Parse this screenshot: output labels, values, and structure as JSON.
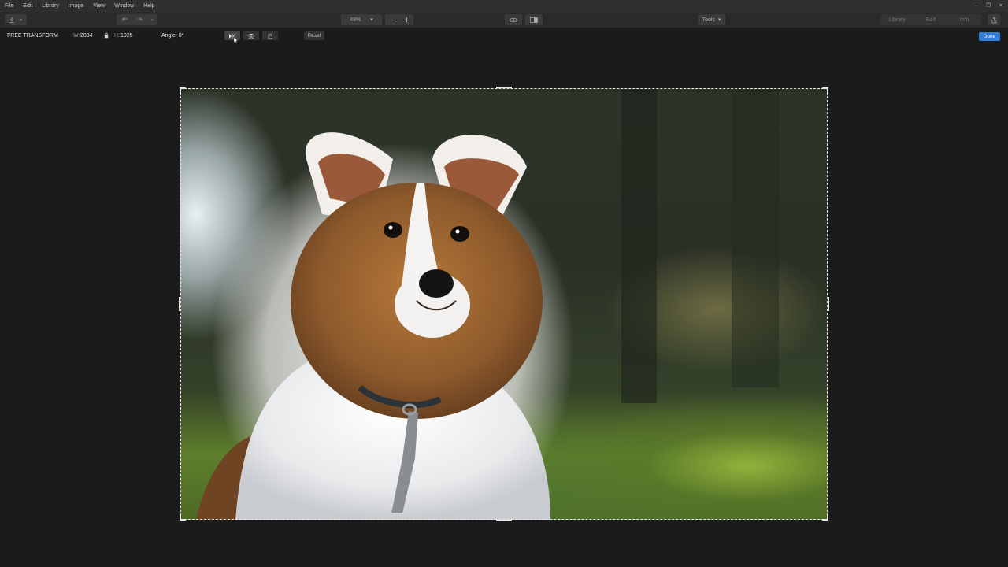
{
  "menu": [
    "File",
    "Edit",
    "Library",
    "Image",
    "View",
    "Window",
    "Help"
  ],
  "window_controls": [
    "–",
    "❐",
    "✕"
  ],
  "toolbar": {
    "zoom": "48%",
    "tools_label": "Tools",
    "tabs": [
      "Library",
      "Edit",
      "Info"
    ]
  },
  "options": {
    "mode_label": "FREE TRANSFORM",
    "w_label": "W:",
    "w_value": "2884",
    "h_label": "H:",
    "h_value": "1925",
    "angle_label": "Angle: 0°",
    "reset_label": "Reset",
    "done_label": "Done"
  },
  "colors": {
    "accent": "#2f7fd8",
    "background": "#1b1b1b"
  }
}
